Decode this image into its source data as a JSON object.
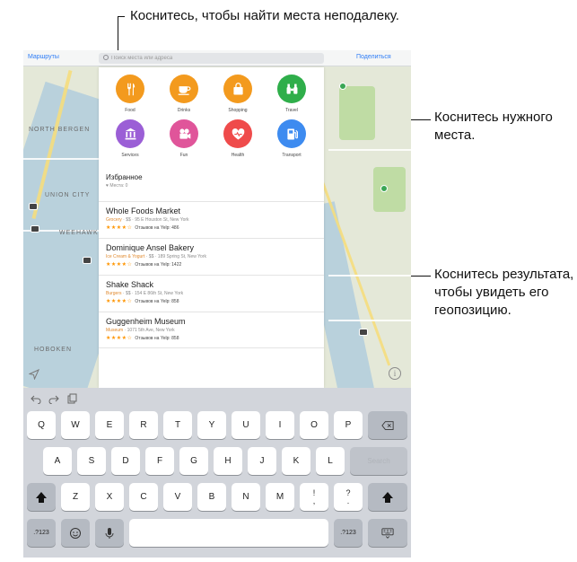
{
  "callouts": {
    "top": "Коснитесь, чтобы найти места неподалеку.",
    "place": "Коснитесь нужного места.",
    "result": "Коснитесь результата, чтобы увидеть его геопозицию."
  },
  "topbar": {
    "left_link": "Маршруты",
    "right_link": "Поделиться",
    "search_placeholder": "Поиск места или адреса"
  },
  "map_labels": {
    "north_bergen": "NORTH BERGEN",
    "union_city": "UNION CITY",
    "weehawken": "WEEHAWKEN",
    "hoboken": "HOBOKEN"
  },
  "categories": [
    {
      "label": "Food",
      "color": "#f39a1e",
      "icon": "fork-knife-icon"
    },
    {
      "label": "Drinks",
      "color": "#f39a1e",
      "icon": "cup-icon"
    },
    {
      "label": "Shopping",
      "color": "#f39a1e",
      "icon": "shopping-bag-icon"
    },
    {
      "label": "Travel",
      "color": "#2fae4a",
      "icon": "binoculars-icon"
    },
    {
      "label": "Services",
      "color": "#9b5fd6",
      "icon": "bank-icon"
    },
    {
      "label": "Fun",
      "color": "#e0559a",
      "icon": "film-icon"
    },
    {
      "label": "Health",
      "color": "#ef4b4b",
      "icon": "heart-icon"
    },
    {
      "label": "Transport",
      "color": "#3d8bf0",
      "icon": "fuel-icon"
    }
  ],
  "favorites": {
    "title": "Избранное",
    "subtitle": "Места: 0"
  },
  "results": [
    {
      "name": "Whole Foods Market",
      "category": "Grocery",
      "details": " · $$ · 95 E Houston St, New York",
      "stars": "★★★★☆",
      "reviews": "Отзывов на Yelp: 486"
    },
    {
      "name": "Dominique Ansel Bakery",
      "category": "Ice Cream & Yogurt",
      "details": " · $$ · 189 Spring St, New York",
      "stars": "★★★★☆",
      "reviews": "Отзывов на Yelp: 1422"
    },
    {
      "name": "Shake Shack",
      "category": "Burgers",
      "details": " · $$ · 154 E 86th St, New York",
      "stars": "★★★★☆",
      "reviews": "Отзывов на Yelp: 858"
    },
    {
      "name": "Guggenheim Museum",
      "category": "Museum",
      "details": " · 1071 5th Ave, New York",
      "stars": "★★★★☆",
      "reviews": "Отзывов на Yelp: 858"
    }
  ],
  "map_controls": {
    "info_glyph": "i"
  },
  "keyboard": {
    "row1": [
      "Q",
      "W",
      "E",
      "R",
      "T",
      "Y",
      "U",
      "I",
      "O",
      "P"
    ],
    "row2": [
      "A",
      "S",
      "D",
      "F",
      "G",
      "H",
      "J",
      "K",
      "L"
    ],
    "row3": [
      "Z",
      "X",
      "C",
      "V",
      "B",
      "N",
      "M"
    ],
    "search_key": "Search",
    "num_key_left": ".?123",
    "num_key_right": ".?123",
    "punct1_top": "!",
    "punct1_bottom": ",",
    "punct2_top": "?",
    "punct2_bottom": "."
  }
}
